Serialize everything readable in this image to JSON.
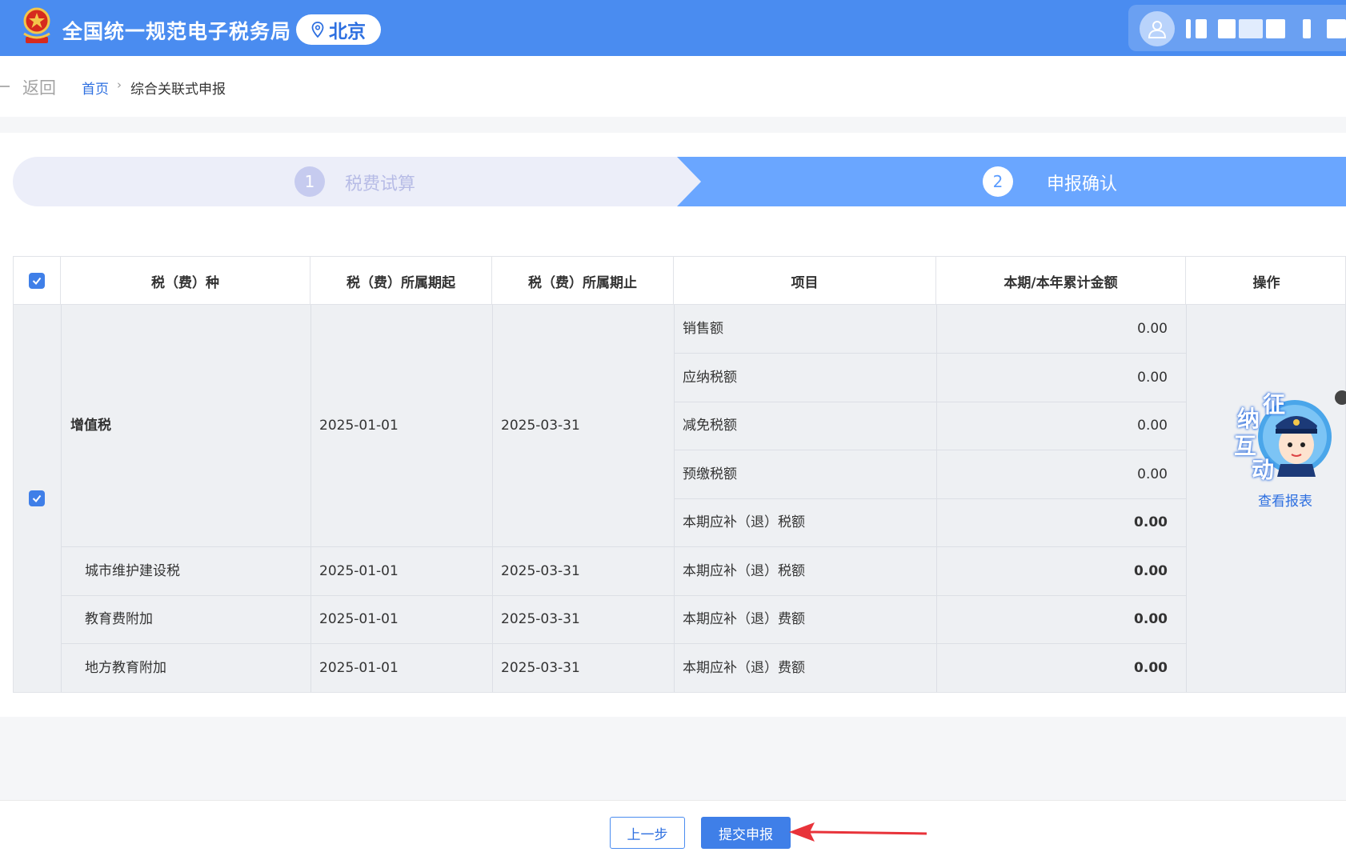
{
  "header": {
    "site_title": "全国统一规范电子税务局",
    "city": "北京",
    "colors": {
      "bar": "#4a8cf0",
      "accent": "#2d6fe0"
    }
  },
  "breadcrumb": {
    "back": "返回",
    "home": "首页",
    "separator": "›",
    "current": "综合关联式申报"
  },
  "steps": [
    {
      "number": "1",
      "label": "税费试算",
      "state": "done"
    },
    {
      "number": "2",
      "label": "申报确认",
      "state": "active"
    }
  ],
  "table": {
    "columns": [
      "税（费）种",
      "税（费）所属期起",
      "税（费）所属期止",
      "项目",
      "本期/本年累计金额",
      "操作"
    ],
    "groups": [
      {
        "tax": "增值税",
        "start": "2025-01-01",
        "end": "2025-03-31",
        "items": [
          {
            "item": "销售额",
            "amount": "0.00"
          },
          {
            "item": "应纳税额",
            "amount": "0.00"
          },
          {
            "item": "减免税额",
            "amount": "0.00"
          },
          {
            "item": "预缴税额",
            "amount": "0.00"
          },
          {
            "item": "本期应补（退）税额",
            "amount": "0.00"
          }
        ]
      },
      {
        "tax": "城市维护建设税",
        "start": "2025-01-01",
        "end": "2025-03-31",
        "items": [
          {
            "item": "本期应补（退）税额",
            "amount": "0.00"
          }
        ]
      },
      {
        "tax": "教育费附加",
        "start": "2025-01-01",
        "end": "2025-03-31",
        "items": [
          {
            "item": "本期应补（退）费额",
            "amount": "0.00"
          }
        ]
      },
      {
        "tax": "地方教育附加",
        "start": "2025-01-01",
        "end": "2025-03-31",
        "items": [
          {
            "item": "本期应补（退）费额",
            "amount": "0.00"
          }
        ]
      }
    ],
    "action": "查看报表"
  },
  "mascot": {
    "chars": [
      "征",
      "纳",
      "互",
      "动"
    ]
  },
  "footer": {
    "prev": "上一步",
    "submit": "提交申报"
  }
}
